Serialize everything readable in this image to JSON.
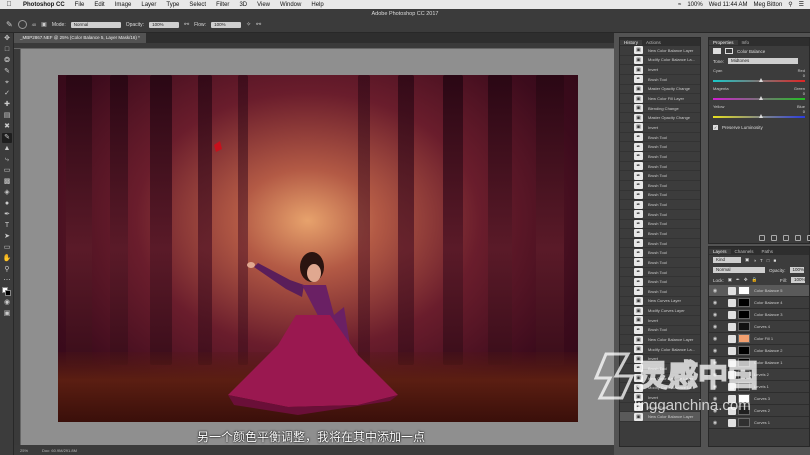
{
  "menubar": {
    "items": [
      "Photoshop CC",
      "File",
      "Edit",
      "Image",
      "Layer",
      "Type",
      "Select",
      "Filter",
      "3D",
      "View",
      "Window",
      "Help"
    ],
    "battery": "100%",
    "time": "Wed 11:44 AM",
    "user": "Meg Bitton"
  },
  "window_title": "Adobe Photoshop CC 2017",
  "options": {
    "mode_label": "Mode:",
    "mode_value": "Normal",
    "opacity_label": "Opacity:",
    "opacity_value": "100%",
    "flow_label": "Flow:",
    "flow_value": "100%",
    "brush_size": "40"
  },
  "document": {
    "tab": "_MBP2867.NEF @ 25% (Color Balance 5, Layer Mask/16) *",
    "zoom": "25%",
    "doc_size": "Doc: 60.9M/291.8M"
  },
  "subtitle": "另一个颜色平衡调整，我将在其中添加一点",
  "history": {
    "tabs": [
      "History",
      "Actions"
    ],
    "items": [
      "New Color Balance Layer",
      "Modify Color Balance La...",
      "Invert",
      "Brush Tool",
      "Master Opacity Change",
      "New Color Fill Layer",
      "Blending Change",
      "Master Opacity Change",
      "Invert",
      "Brush Tool",
      "Brush Tool",
      "Brush Tool",
      "Brush Tool",
      "Brush Tool",
      "Brush Tool",
      "Brush Tool",
      "Brush Tool",
      "Brush Tool",
      "Brush Tool",
      "Brush Tool",
      "Brush Tool",
      "Brush Tool",
      "Brush Tool",
      "Brush Tool",
      "Brush Tool",
      "Brush Tool",
      "New Curves Layer",
      "Modify Curves Layer",
      "Invert",
      "Brush Tool",
      "New Color Balance Layer",
      "Modify Color Balance La...",
      "Invert",
      "Brush Tool",
      "New Color Balance Layer",
      "Modify Color Balance La...",
      "Invert",
      "Brush Tool",
      "New Color Balance Layer"
    ]
  },
  "properties": {
    "tabs": [
      "Properties",
      "Info"
    ],
    "title": "Color Balance",
    "tone_label": "Tone:",
    "tone_value": "Midtones",
    "sliders": [
      {
        "left": "Cyan",
        "right": "Red",
        "value": "0",
        "pos": 0.5,
        "color_l": "#19c8c8",
        "color_r": "#e02424"
      },
      {
        "left": "Magenta",
        "right": "Green",
        "value": "0",
        "pos": 0.5,
        "color_l": "#d01fd0",
        "color_r": "#22c022"
      },
      {
        "left": "Yellow",
        "right": "Blue",
        "value": "0",
        "pos": 0.5,
        "color_l": "#e6e020",
        "color_r": "#2a3be0"
      }
    ],
    "preserve": "Preserve Luminosity"
  },
  "layers": {
    "tabs": [
      "Layers",
      "Channels",
      "Paths"
    ],
    "kind": "Kind",
    "blend": "Normal",
    "opacity_label": "Opacity:",
    "opacity": "100%",
    "lock_label": "Lock:",
    "fill_label": "Fill:",
    "fill": "100%",
    "items": [
      {
        "name": "Color Balance 5",
        "sel": true,
        "thumb": "#ffffff"
      },
      {
        "name": "Color Balance 4",
        "sel": false,
        "thumb": "#000000"
      },
      {
        "name": "Color Balance 3",
        "sel": false,
        "thumb": "#000000"
      },
      {
        "name": "Curves 4",
        "sel": false,
        "thumb": "#111111"
      },
      {
        "name": "Color Fill 1",
        "sel": false,
        "thumb": "#f2a070"
      },
      {
        "name": "Color Balance 2",
        "sel": false,
        "thumb": "#000000"
      },
      {
        "name": "Color Balance 1",
        "sel": false,
        "thumb": "#000000"
      },
      {
        "name": "Levels 2",
        "sel": false,
        "thumb": "#222222"
      },
      {
        "name": "Levels 1",
        "sel": false,
        "thumb": "#333333"
      },
      {
        "name": "Curves 3",
        "sel": false,
        "thumb": "#ffffff"
      },
      {
        "name": "Curves 2",
        "sel": false,
        "thumb": "#202020"
      },
      {
        "name": "Curves 1",
        "sel": false,
        "thumb": "#303030"
      }
    ]
  },
  "watermark": {
    "brand": "灵感中国",
    "url": "lingganchina.com"
  }
}
